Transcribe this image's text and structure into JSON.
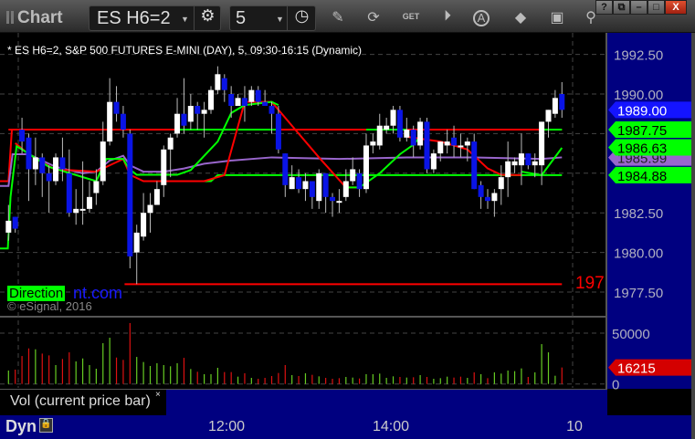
{
  "window": {
    "title": "Chart",
    "symbol": "ES H6=2",
    "interval": "5",
    "window_buttons": [
      "?",
      "⧉",
      "–",
      "□",
      "X"
    ]
  },
  "toolbar": {
    "icons": [
      "settings-icon",
      "clock-icon",
      "pencil-icon",
      "refresh-icon",
      "get-icon",
      "play-icon",
      "a-icon",
      "swap-icon",
      "comment-icon",
      "pin-icon"
    ],
    "get_label": "GET",
    "a_label": "A"
  },
  "chart": {
    "legend": "* ES H6=2, S&P 500 FUTURES E-MINI (DAY), 5, 09:30-16:15 (Dynamic)",
    "watermark_direction": "Direction",
    "watermark_link": "nt.com",
    "copyright": "© eSignal, 2016",
    "stop_label": "197",
    "price_axis": [
      "1992.50",
      "1990.00",
      "1982.50",
      "1980.00",
      "1977.50"
    ],
    "price_axis_values": [
      1992.5,
      1990,
      1982.5,
      1980,
      1977.5
    ],
    "tags": [
      {
        "label": "1989.00",
        "value": 1989.0,
        "bg": "#1414ff",
        "fg": "#ffffff"
      },
      {
        "label": "1985.99",
        "value": 1985.99,
        "bg": "#9966cc",
        "fg": "#222222"
      },
      {
        "label": "1987.75",
        "value": 1987.75,
        "bg": "#00ff00",
        "fg": "#000000"
      },
      {
        "label": "1986.63",
        "value": 1986.63,
        "bg": "#00ff00",
        "fg": "#000000"
      },
      {
        "label": "1984.88",
        "value": 1984.88,
        "bg": "#00ff00",
        "fg": "#000000"
      }
    ],
    "candles": [
      [
        1981.25,
        1983,
        1980.75,
        1982
      ],
      [
        1982.25,
        1982.25,
        1981.25,
        1981.5
      ],
      [
        1987.75,
        1988.5,
        1986.25,
        1987
      ],
      [
        1987.25,
        1987.5,
        1983.25,
        1985.25
      ],
      [
        1985.25,
        1987.25,
        1984.25,
        1986
      ],
      [
        1986,
        1986.25,
        1983.5,
        1985
      ],
      [
        1985,
        1985.5,
        1982.5,
        1984.5
      ],
      [
        1984.5,
        1986.25,
        1984.25,
        1986
      ],
      [
        1986,
        1987.25,
        1984.5,
        1985.25
      ],
      [
        1985,
        1986.5,
        1982.25,
        1982.5
      ],
      [
        1982.5,
        1984,
        1981.75,
        1982.75
      ],
      [
        1982.75,
        1985.75,
        1981.75,
        1982.75
      ],
      [
        1982.75,
        1984.5,
        1982.5,
        1983.5
      ],
      [
        1983.75,
        1985.25,
        1983,
        1984.5
      ],
      [
        1984.5,
        1988.25,
        1984.25,
        1987
      ],
      [
        1987,
        1991,
        1986.75,
        1989.5
      ],
      [
        1989.5,
        1990.5,
        1988.25,
        1988.75
      ],
      [
        1988.75,
        1989.25,
        1987.25,
        1987.75
      ],
      [
        1987.5,
        1987.75,
        1979,
        1979.75
      ],
      [
        1980,
        1981.75,
        1978,
        1981.25
      ],
      [
        1981,
        1983.75,
        1980.75,
        1982.5
      ],
      [
        1982.5,
        1983.75,
        1981.25,
        1983
      ],
      [
        1983,
        1984.5,
        1983,
        1984
      ],
      [
        1984.25,
        1986.75,
        1983.5,
        1986.5
      ],
      [
        1986.5,
        1987.5,
        1984.75,
        1987.25
      ],
      [
        1987.5,
        1989.75,
        1987.25,
        1988.75
      ],
      [
        1988.75,
        1991,
        1987.5,
        1988
      ],
      [
        1988.25,
        1990,
        1987.75,
        1989.25
      ],
      [
        1989.25,
        1989.5,
        1987.75,
        1988.75
      ],
      [
        1988.75,
        1989.5,
        1987.25,
        1989
      ],
      [
        1989,
        1990.5,
        1988.75,
        1990.25
      ],
      [
        1990.25,
        1991.75,
        1990,
        1991.25
      ],
      [
        1991,
        1991.25,
        1989.5,
        1990.25
      ],
      [
        1990,
        1990.5,
        1988.5,
        1989.25
      ],
      [
        1989.25,
        1990,
        1989.25,
        1989.75
      ],
      [
        1989.75,
        1990.5,
        1988.25,
        1989.25
      ],
      [
        1989.5,
        1990.5,
        1989.25,
        1990.25
      ],
      [
        1990.25,
        1990.5,
        1989.25,
        1989.5
      ],
      [
        1989.5,
        1990.25,
        1989.25,
        1989.25
      ],
      [
        1989.25,
        1989.5,
        1987.5,
        1988.75
      ],
      [
        1988.75,
        1989.25,
        1986.25,
        1986.5
      ],
      [
        1986.25,
        1986.25,
        1983.5,
        1984.25
      ],
      [
        1984,
        1985.5,
        1984,
        1984.75
      ],
      [
        1984.75,
        1985.25,
        1983.75,
        1984
      ],
      [
        1984,
        1985,
        1983.25,
        1984.5
      ],
      [
        1984.5,
        1984.5,
        1982.75,
        1983.5
      ],
      [
        1983.25,
        1985.25,
        1982.75,
        1985
      ],
      [
        1985,
        1985,
        1982.5,
        1983.5
      ],
      [
        1983.5,
        1983.75,
        1982.25,
        1983.25
      ],
      [
        1983.25,
        1984,
        1982.5,
        1983.25
      ],
      [
        1983.5,
        1985.25,
        1983.25,
        1984.5
      ],
      [
        1984.5,
        1986,
        1984.25,
        1985.25
      ],
      [
        1985,
        1985.25,
        1983.5,
        1984
      ],
      [
        1984,
        1987.5,
        1983.75,
        1986.75
      ],
      [
        1986.75,
        1987.5,
        1986.25,
        1987
      ],
      [
        1986.75,
        1988.75,
        1986.5,
        1988
      ],
      [
        1987.75,
        1988.5,
        1987.5,
        1988
      ],
      [
        1988,
        1989.25,
        1987.5,
        1989
      ],
      [
        1989,
        1989.25,
        1987,
        1987.25
      ],
      [
        1987.25,
        1988.5,
        1987,
        1987.75
      ],
      [
        1987.75,
        1988,
        1986,
        1986.75
      ],
      [
        1986.75,
        1988.5,
        1986.5,
        1988.25
      ],
      [
        1988.25,
        1988.5,
        1985,
        1985.25
      ],
      [
        1985.25,
        1986.5,
        1985,
        1986.25
      ],
      [
        1986.25,
        1987,
        1985.75,
        1987
      ],
      [
        1986.75,
        1987.75,
        1986.25,
        1987
      ],
      [
        1987.25,
        1988,
        1986,
        1986.75
      ],
      [
        1986.75,
        1987.5,
        1986,
        1986.75
      ],
      [
        1986.75,
        1987.25,
        1985.75,
        1987
      ],
      [
        1987,
        1987.5,
        1984,
        1984
      ],
      [
        1984.25,
        1984.5,
        1982.75,
        1983.5
      ],
      [
        1983.5,
        1984,
        1982.75,
        1983.25
      ],
      [
        1983.25,
        1984,
        1982.25,
        1983.75
      ],
      [
        1984,
        1985.5,
        1983,
        1984.75
      ],
      [
        1984.75,
        1987,
        1983.5,
        1985.75
      ],
      [
        1985.5,
        1986,
        1985,
        1985.75
      ],
      [
        1985.5,
        1987.5,
        1984.25,
        1986.25
      ],
      [
        1986.25,
        1986.25,
        1985.25,
        1985.5
      ],
      [
        1985.5,
        1986.25,
        1984.75,
        1985.75
      ],
      [
        1985.5,
        1988.25,
        1984.25,
        1988.25
      ],
      [
        1988.25,
        1989,
        1987.25,
        1989
      ],
      [
        1988.75,
        1990.25,
        1988.5,
        1989.75
      ],
      [
        1990,
        1990.75,
        1988.5,
        1989
      ]
    ],
    "lines": [
      {
        "name": "red-horizontal-line",
        "color": "#ff0000",
        "points": [
          [
            1,
            1987.75
          ],
          [
            83,
            1987.75
          ]
        ]
      },
      {
        "name": "green-horizontal-upper",
        "color": "#00ff00",
        "points": [
          [
            26,
            1987.75
          ],
          [
            41,
            1987.75
          ]
        ]
      },
      {
        "name": "green-horizontal-upper-2",
        "color": "#00ff00",
        "points": [
          [
            54,
            1987.75
          ],
          [
            60,
            1987.75
          ]
        ]
      },
      {
        "name": "green-horizontal-upper-3",
        "color": "#00ff00",
        "points": [
          [
            80,
            1987.75
          ],
          [
            83,
            1987.75
          ]
        ]
      },
      {
        "name": "red-horizontal-lower",
        "color": "#ff0000",
        "points": [
          [
            -0.3,
            1984.5
          ],
          [
            1,
            1984.5
          ],
          [
            1.5,
            1987.75
          ],
          [
            2,
            1987.75
          ]
        ]
      },
      {
        "name": "green-horizontal-lower",
        "color": "#00ff00",
        "points": [
          [
            24,
            1984.5
          ],
          [
            31,
            1984.5
          ],
          [
            32,
            1984.88
          ],
          [
            83,
            1984.88
          ]
        ]
      },
      {
        "name": "red-stop-line",
        "color": "#ff0000",
        "points": [
          [
            18.2,
            1978
          ],
          [
            83,
            1978
          ]
        ]
      },
      {
        "name": "purple-moving-average",
        "color": "#9966cc",
        "points": [
          [
            -0.3,
            1984.2
          ],
          [
            1,
            1984.2
          ],
          [
            1.6,
            1986.2
          ],
          [
            4,
            1986.2
          ],
          [
            8,
            1985.4
          ],
          [
            12,
            1985.0
          ],
          [
            14,
            1985.1
          ],
          [
            16,
            1985.8
          ],
          [
            18,
            1986.1
          ],
          [
            19,
            1985.5
          ],
          [
            21,
            1985.1
          ],
          [
            24,
            1985.1
          ],
          [
            27,
            1985.3
          ],
          [
            30,
            1985.6
          ],
          [
            34,
            1985.8
          ],
          [
            40,
            1986.0
          ],
          [
            50,
            1985.9
          ],
          [
            60,
            1986.0
          ],
          [
            70,
            1986.0
          ],
          [
            80,
            1985.9
          ],
          [
            83,
            1986.0
          ]
        ]
      },
      {
        "name": "red-trailing-curve",
        "color": "#ff0000",
        "points": [
          [
            2,
            1986.9
          ],
          [
            4,
            1986.2
          ],
          [
            8,
            1985.2
          ],
          [
            10,
            1985.2
          ],
          [
            14,
            1985.1
          ],
          [
            16,
            1985.5
          ],
          [
            18,
            1985.9
          ],
          [
            19,
            1984.9
          ],
          [
            21,
            1984.5
          ],
          [
            30,
            1984.5
          ],
          [
            33,
            1984.88
          ],
          [
            36,
            1989.5
          ],
          [
            40,
            1989.5
          ],
          [
            43,
            1988.0
          ],
          [
            47,
            1986.0
          ],
          [
            51,
            1984.1
          ],
          [
            53,
            1984.1
          ]
        ]
      },
      {
        "name": "red-trailing-curve-2",
        "color": "#ff0000",
        "points": [
          [
            60,
            1987.3
          ],
          [
            65,
            1987.0
          ],
          [
            69,
            1986.5
          ],
          [
            72,
            1985.3
          ],
          [
            74,
            1984.9
          ],
          [
            77,
            1984.88
          ]
        ]
      },
      {
        "name": "green-trailing-curve",
        "color": "#00ff00",
        "points": [
          [
            -0.3,
            1980.25
          ],
          [
            0.9,
            1980.25
          ],
          [
            1.3,
            1983.5
          ],
          [
            2.2,
            1986.7
          ],
          [
            3,
            1986.5
          ],
          [
            7,
            1985.4
          ],
          [
            14,
            1984.5
          ],
          [
            15.5,
            1985.9
          ],
          [
            17,
            1985.9
          ],
          [
            18,
            1985.9
          ],
          [
            18.8,
            1985.3
          ],
          [
            20,
            1984.9
          ],
          [
            26,
            1984.9
          ],
          [
            28,
            1985.2
          ],
          [
            32,
            1987.0
          ],
          [
            34,
            1988.8
          ],
          [
            36,
            1989.3
          ],
          [
            40,
            1989.5
          ],
          [
            41,
            1989.3
          ]
        ]
      },
      {
        "name": "green-trailing-curve-2",
        "color": "#00ff00",
        "points": [
          [
            51,
            1984.1
          ],
          [
            53,
            1984.1
          ],
          [
            56,
            1985.0
          ],
          [
            59,
            1986.2
          ],
          [
            61,
            1986.8
          ],
          [
            62,
            1987.3
          ]
        ]
      },
      {
        "name": "green-trailing-curve-3",
        "color": "#00ff00",
        "points": [
          [
            77,
            1985.1
          ],
          [
            80,
            1984.88
          ],
          [
            83,
            1986.6
          ]
        ]
      }
    ]
  },
  "volume": {
    "axis": [
      "50000",
      "0"
    ],
    "axis_values": [
      50000,
      0
    ],
    "current_label": "16215",
    "current_value": 16215,
    "panel_label": "Vol (current price bar)",
    "close_label": "×",
    "up_color": "#66cc22",
    "down_color": "#dd1111",
    "bars": [
      [
        13200,
        1
      ],
      [
        14100,
        0
      ],
      [
        27500,
        0
      ],
      [
        35000,
        0
      ],
      [
        34100,
        1
      ],
      [
        29900,
        0
      ],
      [
        28100,
        0
      ],
      [
        18600,
        1
      ],
      [
        24600,
        0
      ],
      [
        31100,
        0
      ],
      [
        22200,
        1
      ],
      [
        25100,
        1
      ],
      [
        18600,
        1
      ],
      [
        15000,
        1
      ],
      [
        40100,
        1
      ],
      [
        45500,
        1
      ],
      [
        26000,
        0
      ],
      [
        23700,
        0
      ],
      [
        59900,
        0
      ],
      [
        26600,
        1
      ],
      [
        21600,
        1
      ],
      [
        17700,
        1
      ],
      [
        20400,
        1
      ],
      [
        18600,
        1
      ],
      [
        17400,
        1
      ],
      [
        20400,
        1
      ],
      [
        25700,
        0
      ],
      [
        14700,
        1
      ],
      [
        12000,
        0
      ],
      [
        9600,
        1
      ],
      [
        9600,
        1
      ],
      [
        15900,
        1
      ],
      [
        11700,
        0
      ],
      [
        11700,
        0
      ],
      [
        7200,
        1
      ],
      [
        10500,
        0
      ],
      [
        6000,
        1
      ],
      [
        5100,
        0
      ],
      [
        6000,
        0
      ],
      [
        7800,
        0
      ],
      [
        10800,
        0
      ],
      [
        18600,
        0
      ],
      [
        8700,
        1
      ],
      [
        7800,
        0
      ],
      [
        10500,
        1
      ],
      [
        9000,
        0
      ],
      [
        7500,
        1
      ],
      [
        6000,
        0
      ],
      [
        5100,
        0
      ],
      [
        5700,
        0
      ],
      [
        6900,
        1
      ],
      [
        6300,
        1
      ],
      [
        5400,
        0
      ],
      [
        9600,
        1
      ],
      [
        9600,
        1
      ],
      [
        10200,
        1
      ],
      [
        6000,
        1
      ],
      [
        7500,
        1
      ],
      [
        6900,
        0
      ],
      [
        6300,
        1
      ],
      [
        6600,
        0
      ],
      [
        8700,
        1
      ],
      [
        6900,
        0
      ],
      [
        5100,
        1
      ],
      [
        5700,
        1
      ],
      [
        7200,
        1
      ],
      [
        6300,
        0
      ],
      [
        7200,
        0
      ],
      [
        6000,
        1
      ],
      [
        11400,
        0
      ],
      [
        9600,
        1
      ],
      [
        5700,
        0
      ],
      [
        11400,
        1
      ],
      [
        10200,
        1
      ],
      [
        13200,
        1
      ],
      [
        12600,
        1
      ],
      [
        15300,
        1
      ],
      [
        6900,
        0
      ],
      [
        11400,
        1
      ],
      [
        39200,
        1
      ],
      [
        31100,
        1
      ],
      [
        8100,
        1
      ],
      [
        16215,
        0
      ]
    ]
  },
  "time_axis": {
    "mode": "Dyn",
    "ticks": [
      "12:00",
      "14:00",
      "10"
    ]
  }
}
